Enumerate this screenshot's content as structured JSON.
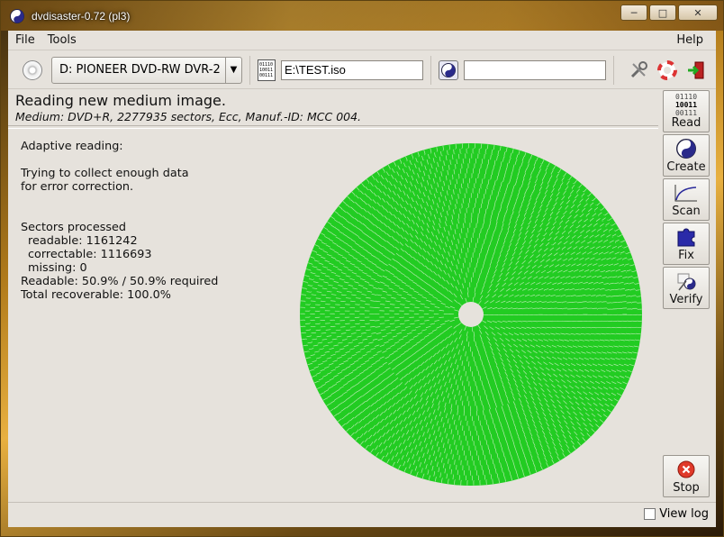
{
  "window": {
    "title": "dvdisaster-0.72 (pl3)",
    "minimize": "─",
    "maximize": "□",
    "close": "✕"
  },
  "menu": {
    "file": "File",
    "tools": "Tools",
    "help": "Help"
  },
  "toolbar": {
    "drive": "D: PIONEER DVD-RW DVR-2",
    "file_icon_lines": [
      "01110",
      "10011",
      "00111"
    ],
    "image_file": "E:\\TEST.iso",
    "ecc_file": ""
  },
  "status": {
    "title": "Reading new medium image.",
    "medium": "Medium: DVD+R, 2277935 sectors, Ecc, Manuf.-ID: MCC      004."
  },
  "info": {
    "mode": "Adaptive reading:",
    "line1": "Trying to collect enough data",
    "line2": "for error correction.",
    "sectors_header": "Sectors processed",
    "readable": "readable: 1161242",
    "correctable": "correctable: 1116693",
    "missing": "missing: 0",
    "readable_pct": "Readable: 50.9% / 50.9% required",
    "recoverable": "Total recoverable: 100.0%"
  },
  "sidebar": {
    "read": "Read",
    "create": "Create",
    "scan": "Scan",
    "fix": "Fix",
    "verify": "Verify",
    "stop": "Stop",
    "read_icon_lines": [
      "01110",
      "10011",
      "00111"
    ]
  },
  "footer": {
    "view_log": "View log"
  },
  "colors": {
    "sector_ok": "#22cc22",
    "background": "#e6e2dc",
    "stop_red": "#e03a2a"
  }
}
